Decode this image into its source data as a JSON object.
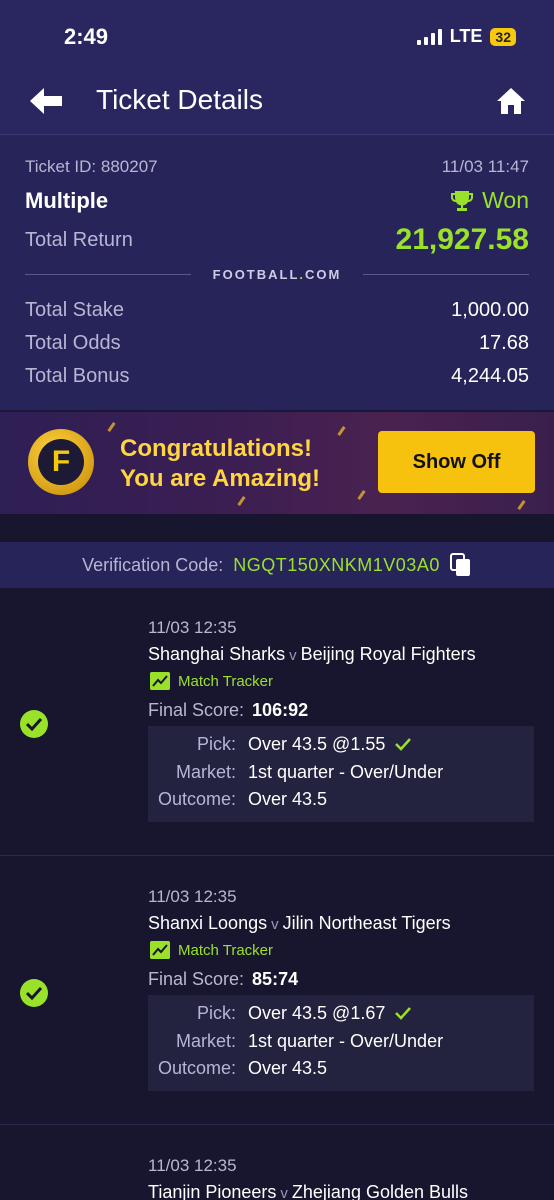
{
  "status_bar": {
    "time": "2:49",
    "network": "LTE",
    "battery": "32"
  },
  "header": {
    "title": "Ticket Details"
  },
  "ticket": {
    "id_label": "Ticket ID: 880207",
    "datetime": "11/03 11:47",
    "type": "Multiple",
    "status": "Won",
    "return_label": "Total Return",
    "return_value": "21,927.58",
    "brand": {
      "left": "FOOTBALL",
      "dot": ".",
      "right": "COM"
    },
    "stats": [
      {
        "label": "Total Stake",
        "value": "1,000.00"
      },
      {
        "label": "Total Odds",
        "value": "17.68"
      },
      {
        "label": "Total Bonus",
        "value": "4,244.05"
      }
    ]
  },
  "banner": {
    "line1": "Congratulations!",
    "line2": "You are Amazing!",
    "button": "Show Off",
    "logo_letter": "F"
  },
  "verification": {
    "label": "Verification Code:",
    "code": "NGQT150XNKM1V03A0"
  },
  "bets": [
    {
      "date": "11/03 12:35",
      "home": "Shanghai Sharks",
      "vs": "v",
      "away": "Beijing Royal Fighters",
      "tracker": "Match Tracker",
      "score_label": "Final Score:",
      "score": "106:92",
      "pick_label": "Pick:",
      "pick": "Over 43.5 @1.55",
      "market_label": "Market:",
      "market": "1st quarter - Over/Under",
      "outcome_label": "Outcome:",
      "outcome": "Over 43.5"
    },
    {
      "date": "11/03 12:35",
      "home": "Shanxi Loongs",
      "vs": "v",
      "away": "Jilin Northeast Tigers",
      "tracker": "Match Tracker",
      "score_label": "Final Score:",
      "score": "85:74",
      "pick_label": "Pick:",
      "pick": "Over 43.5 @1.67",
      "market_label": "Market:",
      "market": "1st quarter - Over/Under",
      "outcome_label": "Outcome:",
      "outcome": "Over 43.5"
    },
    {
      "date": "11/03 12:35",
      "home": "Tianjin Pioneers",
      "vs": "v",
      "away": "Zhejiang Golden Bulls"
    }
  ],
  "colors": {
    "accent": "#9ae22a",
    "header_bg": "#2a2760",
    "banner_button": "#f6c20e"
  }
}
